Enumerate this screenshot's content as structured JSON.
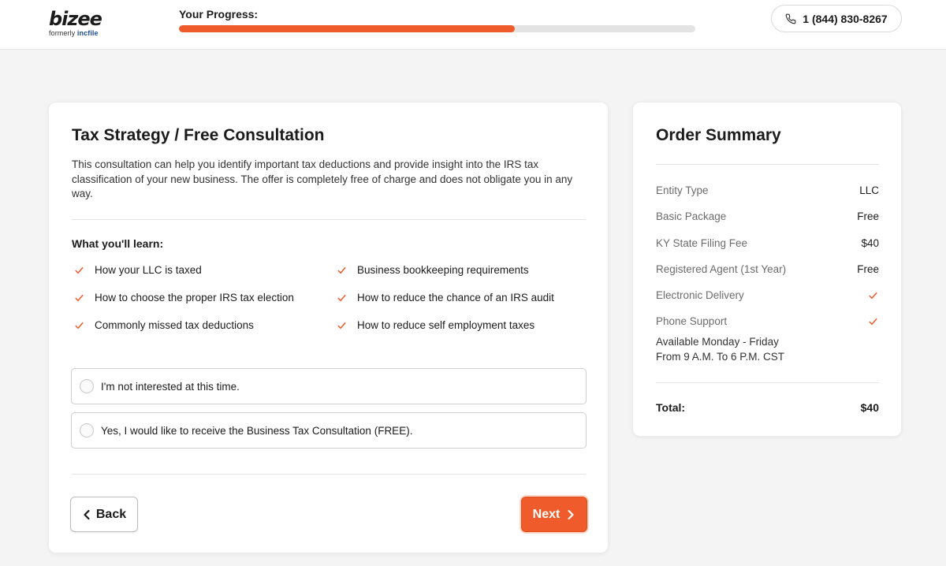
{
  "brand": {
    "logo_text": "bizee",
    "formerly": "formerly",
    "formerly_brand": "incfile"
  },
  "header": {
    "progress_label": "Your Progress:",
    "progress_value": 0.65,
    "phone": "1 (844) 830-8267",
    "accent_color": "#ef5b2b"
  },
  "main": {
    "title": "Tax Strategy / Free Consultation",
    "description": "This consultation can help you identify important tax deductions and provide insight into the IRS tax classification of your new business. The offer is completely free of charge and does not obligate you in any way.",
    "learn_label": "What you'll learn:",
    "learn_items": [
      "How your LLC is taxed",
      "Business bookkeeping requirements",
      "How to choose the proper IRS tax election",
      "How to reduce the chance of an IRS audit",
      "Commonly missed tax deductions",
      "How to reduce self employment taxes"
    ],
    "options": [
      {
        "label": "I'm not interested at this time.",
        "selected": false
      },
      {
        "label": "Yes, I would like to receive the Business Tax Consultation (FREE).",
        "selected": false
      }
    ],
    "back_label": "Back",
    "next_label": "Next"
  },
  "summary": {
    "title": "Order Summary",
    "rows": [
      {
        "label": "Entity Type",
        "value": "LLC"
      },
      {
        "label": "Basic Package",
        "value": "Free"
      },
      {
        "label": "KY State Filing Fee",
        "value": "$40"
      },
      {
        "label": "Registered Agent (1st Year)",
        "value": "Free"
      },
      {
        "label": "Electronic Delivery",
        "value": "check-icon"
      },
      {
        "label": "Phone Support",
        "value": "check-icon"
      }
    ],
    "support_hours_line1": "Available Monday - Friday",
    "support_hours_line2": "From 9 A.M. To 6 P.M. CST",
    "total_label": "Total:",
    "total_value": "$40"
  }
}
